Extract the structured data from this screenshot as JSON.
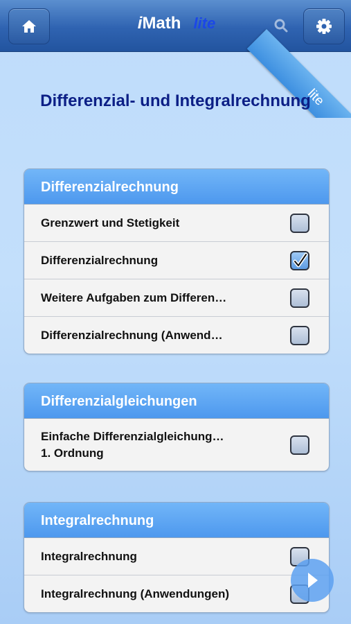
{
  "header": {
    "app_prefix": "i",
    "app_name": "Math",
    "app_edition": "lite",
    "ribbon_label": "lite",
    "icons": {
      "home": "home-icon",
      "search": "search-icon",
      "settings": "gear-icon"
    }
  },
  "page_title": "Differenzial- und Integralrechnung",
  "sections": [
    {
      "title": "Differenzialrechnung",
      "items": [
        {
          "label": "Grenzwert und Stetigkeit",
          "checked": false
        },
        {
          "label": "Differenzialrechnung",
          "checked": true
        },
        {
          "label": "Weitere Aufgaben zum Differen…",
          "checked": false
        },
        {
          "label": "Differenzialrechnung (Anwend…",
          "checked": false
        }
      ]
    },
    {
      "title": "Differenzialgleichungen",
      "items": [
        {
          "label": "Einfache Differenzialgleichung…\n1. Ordnung",
          "checked": false
        }
      ]
    },
    {
      "title": "Integralrechnung",
      "items": [
        {
          "label": "Integralrechnung",
          "checked": false
        },
        {
          "label": "Integralrechnung (Anwendungen)",
          "checked": false
        }
      ]
    }
  ],
  "next_button": {
    "icon": "play-icon"
  },
  "colors": {
    "accent": "#4d98ee",
    "title_text": "#0c1f86",
    "header_bar": "#2f63b1",
    "edition_text": "#1b47e8"
  }
}
